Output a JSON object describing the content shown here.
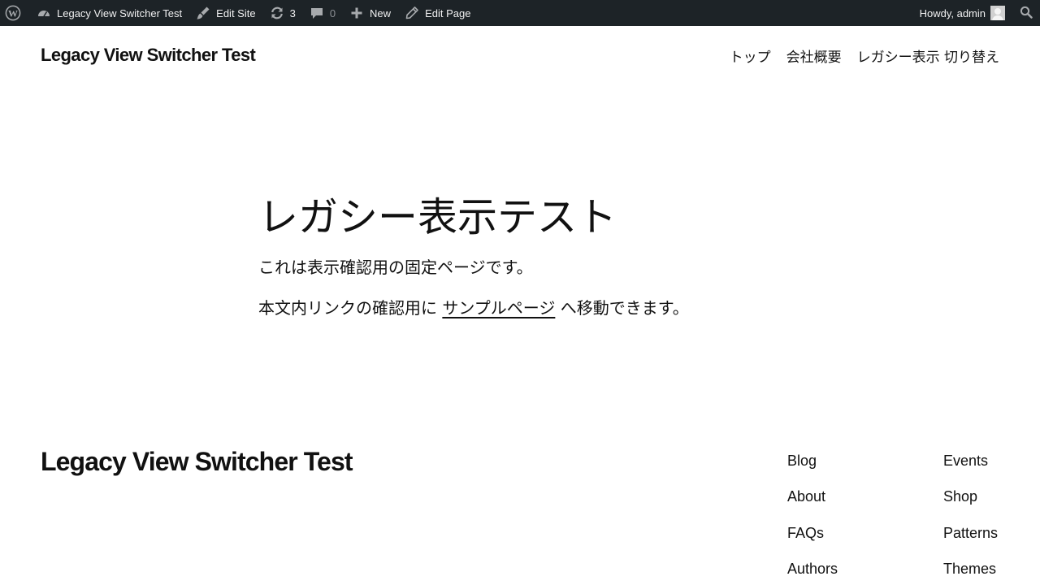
{
  "admin_bar": {
    "site_name": "Legacy View Switcher Test",
    "edit_site": "Edit Site",
    "updates_count": "3",
    "comments_count": "0",
    "new_label": "New",
    "edit_page": "Edit Page",
    "howdy": "Howdy, admin",
    "icons": [
      "wordpress-logo-icon",
      "dashboard-icon",
      "brush-icon",
      "updates-icon",
      "comment-icon",
      "plus-icon",
      "pencil-icon",
      "avatar",
      "search-icon"
    ]
  },
  "header": {
    "site_title": "Legacy View Switcher Test",
    "nav": [
      "トップ",
      "会社概要",
      "レガシー表示 切り替え"
    ]
  },
  "main": {
    "title": "レガシー表示テスト",
    "paragraph1": "これは表示確認用の固定ページです。",
    "paragraph2_before": "本文内リンクの確認用に",
    "paragraph2_link": "サンプルページ",
    "paragraph2_after": "へ移動できます。"
  },
  "footer": {
    "site_title": "Legacy View Switcher Test",
    "column1": [
      "Blog",
      "About",
      "FAQs",
      "Authors"
    ],
    "column2": [
      "Events",
      "Shop",
      "Patterns",
      "Themes"
    ]
  },
  "colors": {
    "admin_bar_bg": "#1d2327",
    "admin_bar_text": "#f0f0f1",
    "text": "#111111",
    "background": "#ffffff"
  }
}
